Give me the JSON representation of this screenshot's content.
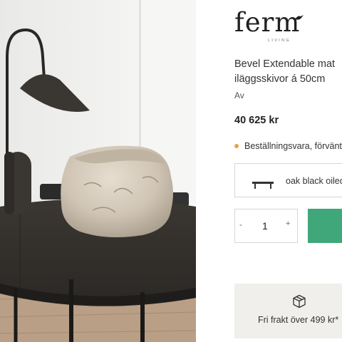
{
  "brand": {
    "name": "ferm",
    "sub": "LIVING",
    "icon": "bird-icon"
  },
  "product": {
    "title_line1": "Bevel Extendable mat",
    "title_line2": "iläggsskivor á 50cm",
    "by_label": "Av",
    "price": "40 625 kr",
    "stock_text": "Beställningsvara, förvänt",
    "stock_color": "#e7a33c"
  },
  "variant": {
    "label": "oak black oiled",
    "icon": "table-icon"
  },
  "quantity": {
    "value": "1",
    "minus": "-",
    "plus": "+"
  },
  "add_to_cart": {
    "color": "#3fa77a"
  },
  "shipping": {
    "text": "Fri frakt över 499 kr*",
    "icon": "package-icon"
  },
  "colors": {
    "accent": "#3fa77a",
    "shipping_bg": "#f1efeb"
  }
}
